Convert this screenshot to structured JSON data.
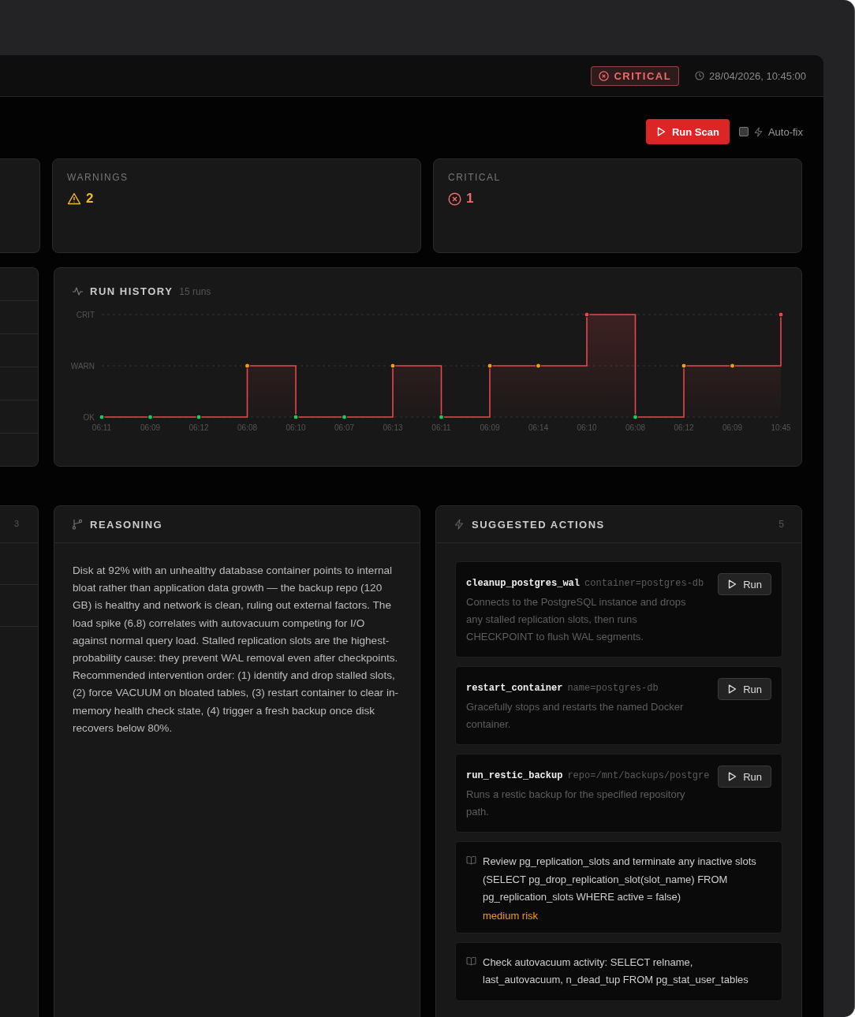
{
  "header": {
    "status": {
      "label": "CRITICAL",
      "kind": "critical"
    },
    "timestamp": "28/04/2026, 10:45:00"
  },
  "toolbar": {
    "run_button": "Run Scan",
    "autofix": {
      "label": "Auto-fix",
      "checked": false
    }
  },
  "stats": [
    {
      "label": "WARNINGS",
      "value": "2",
      "kind": "warning"
    },
    {
      "label": "CRITICAL",
      "value": "1",
      "kind": "critical"
    }
  ],
  "run_history": {
    "title": "RUN HISTORY",
    "count": "15 runs",
    "levels": [
      {
        "label": "CRIT",
        "kind": "critical"
      },
      {
        "label": "WARN",
        "kind": "warning"
      },
      {
        "label": "OK",
        "kind": "ok"
      }
    ],
    "runs": [
      {
        "time": "06:11",
        "kind": "ok"
      },
      {
        "time": "06:09",
        "kind": "ok"
      },
      {
        "time": "06:12",
        "kind": "ok"
      },
      {
        "time": "06:08",
        "kind": "warning"
      },
      {
        "time": "06:10",
        "kind": "ok"
      },
      {
        "time": "06:07",
        "kind": "ok"
      },
      {
        "time": "06:13",
        "kind": "warning"
      },
      {
        "time": "06:11",
        "kind": "ok"
      },
      {
        "time": "06:09",
        "kind": "warning"
      },
      {
        "time": "06:14",
        "kind": "warning"
      },
      {
        "time": "06:10",
        "kind": "critical"
      },
      {
        "time": "06:08",
        "kind": "ok"
      },
      {
        "time": "06:12",
        "kind": "warning"
      },
      {
        "time": "06:09",
        "kind": "warning"
      },
      {
        "time": "10:45",
        "kind": "critical"
      }
    ]
  },
  "left_panel": {
    "count": "3"
  },
  "reasoning": {
    "title": "REASONING",
    "text": "Disk at 92% with an unhealthy database container points to internal bloat rather than application data growth — the backup repo (120 GB) is healthy and network is clean, ruling out external factors. The load spike (6.8) correlates with autovacuum competing for I/O against normal query load. Stalled replication slots are the highest-probability cause: they prevent WAL removal even after checkpoints. Recommended intervention order: (1) identify and drop stalled slots, (2) force VACUUM on bloated tables, (3) restart container to clear in-memory health check state, (4) trigger a fresh backup once disk recovers below 80%."
  },
  "actions": {
    "title": "SUGGESTED ACTIONS",
    "count": "5",
    "items": [
      {
        "kind": "tool",
        "name": "cleanup_postgres_wal",
        "args": "container=postgres-db",
        "description": "Connects to the PostgreSQL instance and drops any stalled replication slots, then runs CHECKPOINT to flush WAL segments.",
        "button": "Run"
      },
      {
        "kind": "tool",
        "name": "restart_container",
        "args": "name=postgres-db",
        "description": "Gracefully stops and restarts the named Docker container.",
        "button": "Run"
      },
      {
        "kind": "tool",
        "name": "run_restic_backup",
        "args": "repo=/mnt/backups/postgre",
        "description": "Runs a restic backup for the specified repository path.",
        "button": "Run"
      },
      {
        "kind": "manual",
        "text": "Review pg_replication_slots and terminate any inactive slots (SELECT pg_drop_replication_slot(slot_name) FROM pg_replication_slots WHERE active = false)",
        "risk": "medium risk"
      },
      {
        "kind": "manual",
        "text": "Check autovacuum activity: SELECT relname, last_autovacuum, n_dead_tup FROM pg_stat_user_tables"
      }
    ]
  }
}
